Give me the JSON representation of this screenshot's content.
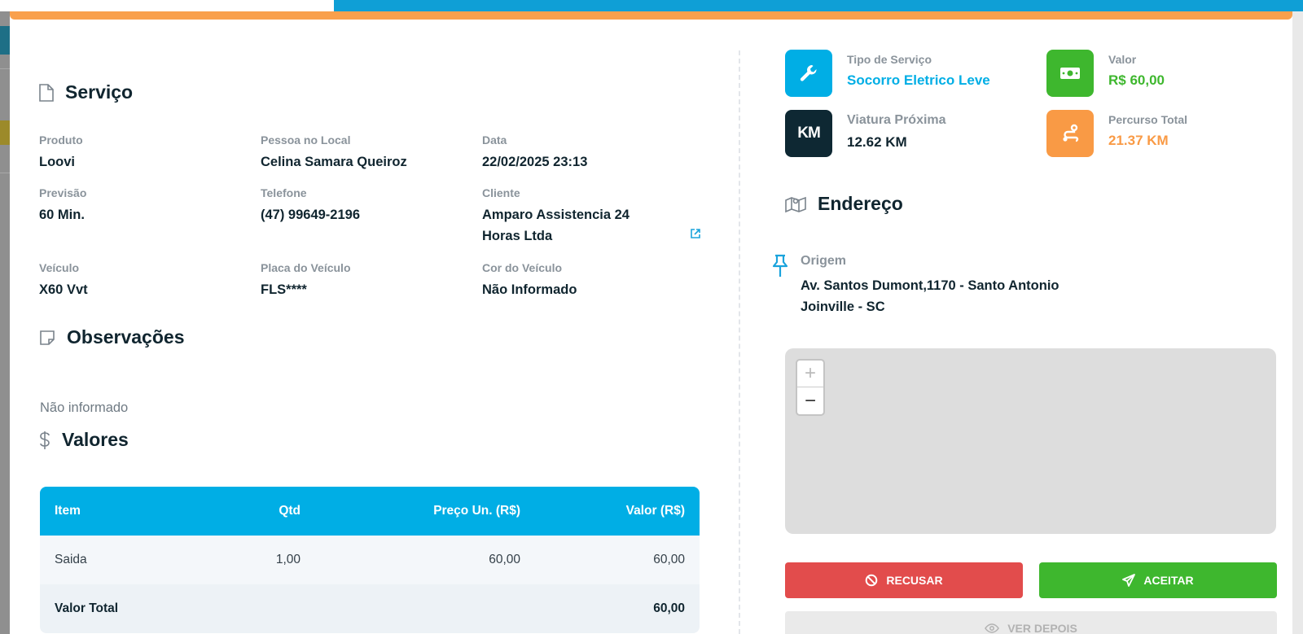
{
  "servico": {
    "title": "Serviço",
    "fields": {
      "produto": {
        "label": "Produto",
        "value": "Loovi"
      },
      "pessoa": {
        "label": "Pessoa no Local",
        "value": "Celina Samara Queiroz"
      },
      "data": {
        "label": "Data",
        "value": "22/02/2025 23:13"
      },
      "previsao": {
        "label": "Previsão",
        "value": "60 Min."
      },
      "telefone": {
        "label": "Telefone",
        "value": "(47) 99649-2196"
      },
      "cliente": {
        "label": "Cliente",
        "value": "Amparo Assistencia 24 Horas Ltda"
      },
      "veiculo": {
        "label": "Veículo",
        "value": "X60 Vvt"
      },
      "placa": {
        "label": "Placa do Veículo",
        "value": "FLS****"
      },
      "cor": {
        "label": "Cor do Veículo",
        "value": "Não Informado"
      }
    }
  },
  "observacoes": {
    "title": "Observações",
    "text": "Não informado"
  },
  "valores": {
    "title": "Valores",
    "headers": {
      "item": "Item",
      "qtd": "Qtd",
      "preco": "Preço Un. (R$)",
      "valor": "Valor (R$)"
    },
    "rows": [
      {
        "item": "Saida",
        "qtd": "1,00",
        "preco": "60,00",
        "valor": "60,00"
      }
    ],
    "total": {
      "label": "Valor Total",
      "value": "60,00"
    }
  },
  "stats": {
    "tipo": {
      "label": "Tipo de Serviço",
      "value": "Socorro Eletrico Leve",
      "color": "#00aee5",
      "icon": "wrench-icon"
    },
    "valor": {
      "label": "Valor",
      "value": "R$ 60,00",
      "color": "#3eb72e",
      "icon": "money-icon"
    },
    "viatura": {
      "label": "Viatura Próxima",
      "value": "12.62 KM",
      "color": "#0e2833",
      "icon": "km-icon",
      "icon_text": "KM"
    },
    "percurso": {
      "label": "Percurso Total",
      "value": "21.37 KM",
      "color": "#f99a45",
      "icon": "route-icon"
    }
  },
  "endereco": {
    "title": "Endereço",
    "origem": {
      "label": "Origem",
      "line1": "Av. Santos Dumont,1170 - Santo Antonio",
      "line2": "Joinville - SC"
    }
  },
  "map": {
    "zoom_in": "+",
    "zoom_out": "−"
  },
  "actions": {
    "refuse": "RECUSAR",
    "accept": "ACEITAR",
    "later": "VER DEPOIS"
  }
}
